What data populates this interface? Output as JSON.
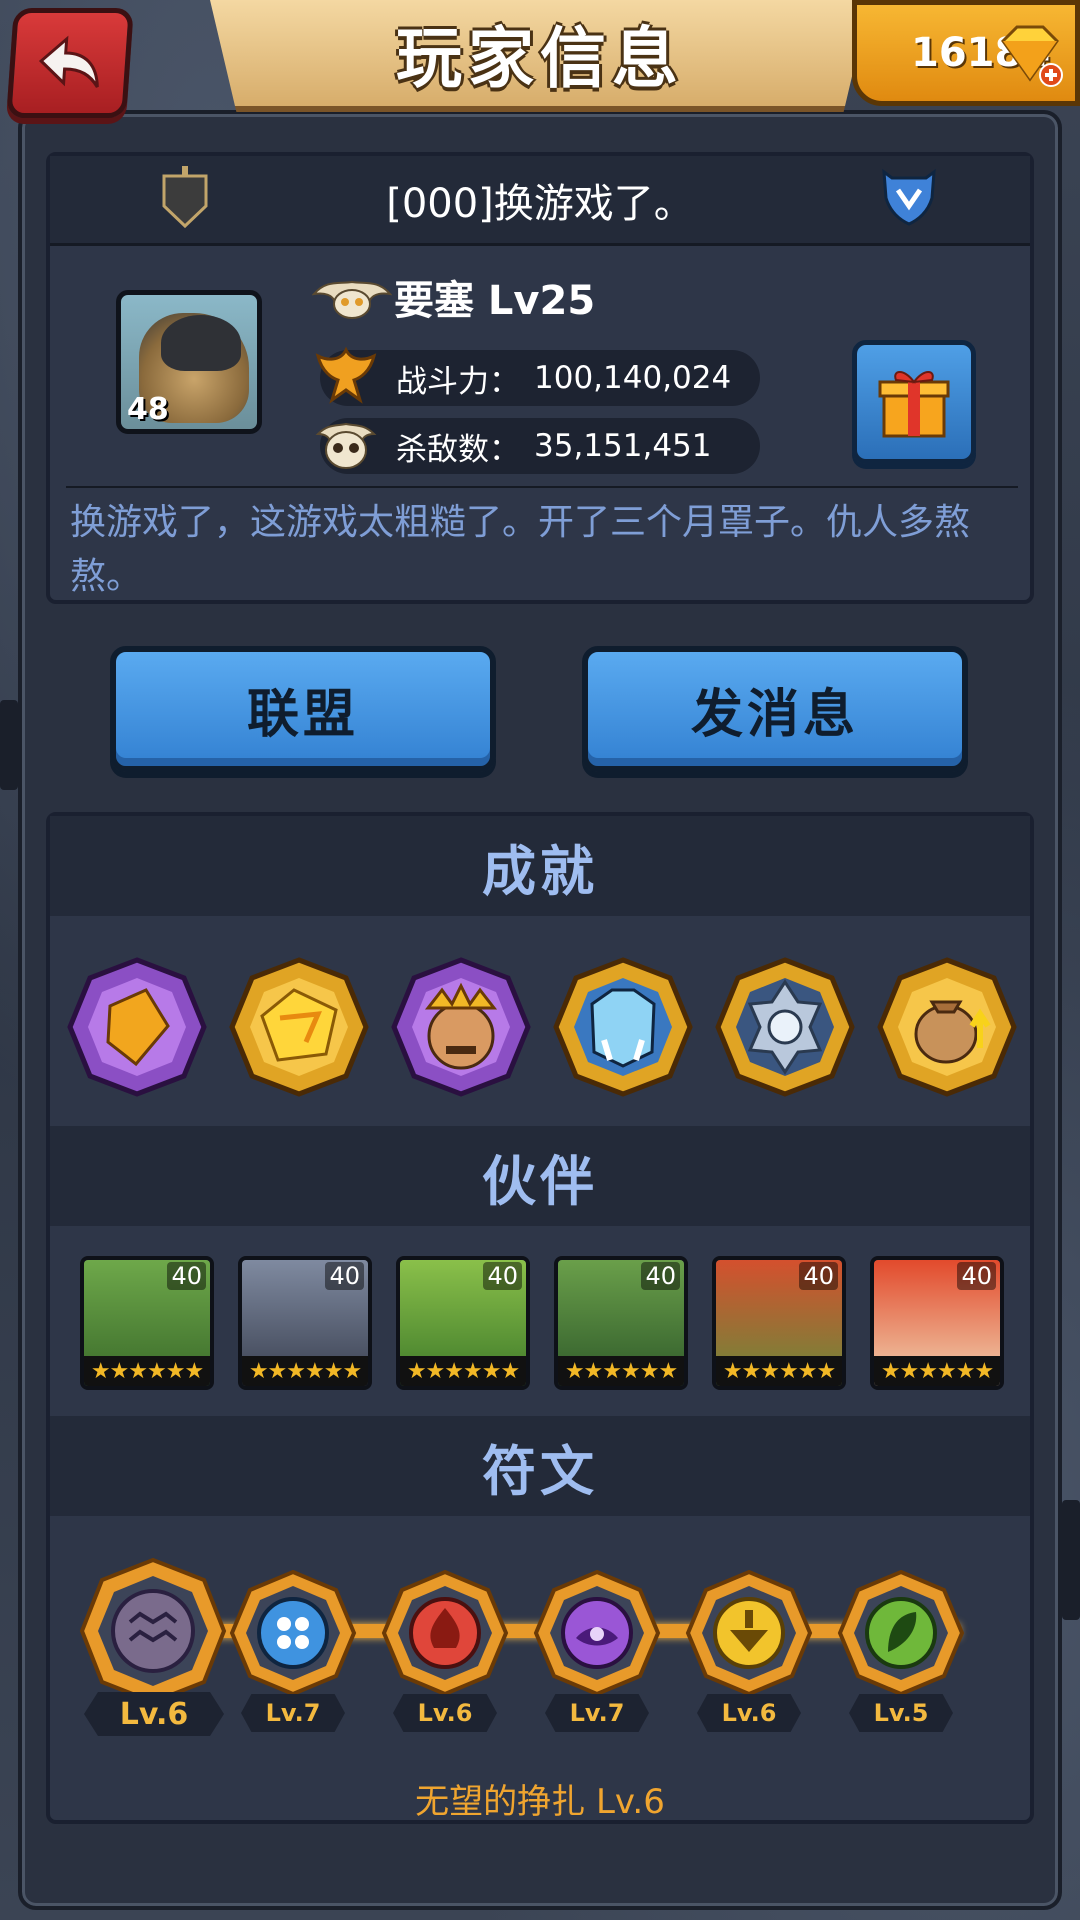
{
  "header": {
    "title": "玩家信息",
    "gems": "16184"
  },
  "player": {
    "name": "[000]换游戏了。",
    "avatar_level": "48",
    "rank": "要塞 Lv25",
    "power_label": "战斗力：",
    "power_value": "100,140,024",
    "kills_label": "杀敌数：",
    "kills_value": "35,151,451",
    "bio": "换游戏了，这游戏太粗糙了。开了三个月罩子。仇人多熬熬。"
  },
  "actions": {
    "alliance": "联盟",
    "message": "发消息"
  },
  "sections": {
    "achievements": "成就",
    "partners": "伙伴",
    "runes": "符文"
  },
  "achievements": [
    {
      "icon": "purple-gem-badge-icon",
      "frame": "#8b4fc4"
    },
    {
      "icon": "gold-ore-badge-icon",
      "frame": "#e0a424"
    },
    {
      "icon": "chief-face-badge-icon",
      "frame": "#8b4fc4"
    },
    {
      "icon": "ice-beast-badge-icon",
      "frame": "#e0a424"
    },
    {
      "icon": "gear-badge-icon",
      "frame": "#e0a424"
    },
    {
      "icon": "money-bag-badge-icon",
      "frame": "#e0a424"
    }
  ],
  "partners": [
    {
      "level": "40",
      "stars": "★★★★★★",
      "color": "#4f8a3a"
    },
    {
      "level": "40",
      "stars": "★★★★★★",
      "color": "#5a6170"
    },
    {
      "level": "40",
      "stars": "★★★★★★",
      "color": "#5f9a3a"
    },
    {
      "level": "40",
      "stars": "★★★★★★",
      "color": "#4a7d3a"
    },
    {
      "level": "40",
      "stars": "★★★★★★",
      "color": "#b53a2a"
    },
    {
      "level": "40",
      "stars": "★★★★★★",
      "color": "#c24a2c"
    }
  ],
  "runes": [
    {
      "level": "Lv.6",
      "color": "#7a6b8c",
      "icon": "water-rune-icon"
    },
    {
      "level": "Lv.7",
      "color": "#3f93e0",
      "icon": "dots-rune-icon"
    },
    {
      "level": "Lv.6",
      "color": "#e0463a",
      "icon": "fire-rune-icon"
    },
    {
      "level": "Lv.7",
      "color": "#9a56d6",
      "icon": "eye-rune-icon"
    },
    {
      "level": "Lv.6",
      "color": "#f2c42c",
      "icon": "tree-rune-icon"
    },
    {
      "level": "Lv.5",
      "color": "#6fb83a",
      "icon": "leaf-rune-icon"
    }
  ],
  "rune_caption": "无望的挣扎 Lv.6"
}
